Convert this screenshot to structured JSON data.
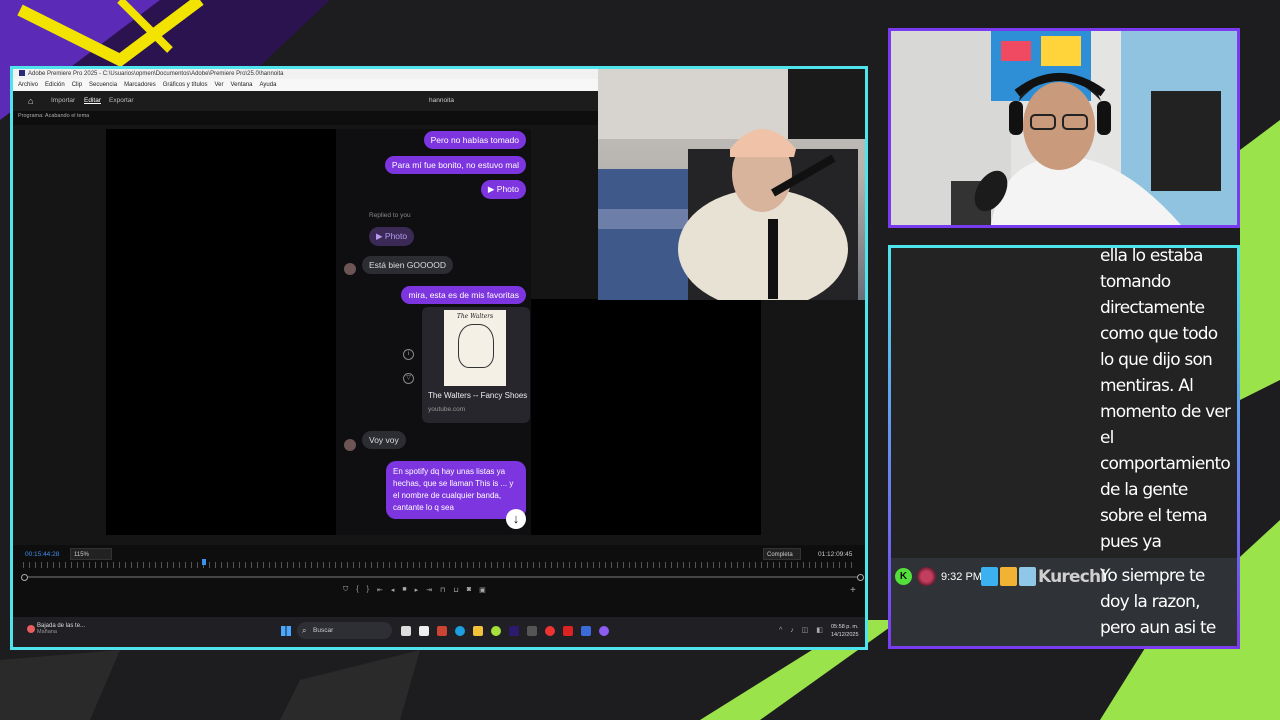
{
  "premiere": {
    "window_title": "Adobe Premiere Pro 2025 - C:\\Usuarios\\opmen\\Documentos\\Adobe\\Premiere Pro\\25.0\\hannoita",
    "menu": [
      "Archivo",
      "Edición",
      "Clip",
      "Secuencia",
      "Marcadores",
      "Gráficos y títulos",
      "Ver",
      "Ventana",
      "Ayuda"
    ],
    "nav": {
      "importar": "Importar",
      "editar": "Editar",
      "exportar": "Exportar"
    },
    "project_name": "hannoita",
    "panel_tab": "Programa: Acabando el tema",
    "timecode_current": "00:15:44:28",
    "zoom": "115%",
    "quality": "Completa",
    "timecode_duration": "01:12:09:45"
  },
  "chat_screenshot": {
    "messages": [
      {
        "text": "Pero no habías tomado",
        "from": "me"
      },
      {
        "text": "Para mí fue bonito, no estuvo mal",
        "from": "me"
      },
      {
        "text": "▶ Photo",
        "from": "me"
      },
      {
        "text": "Replied to you",
        "from": "meta"
      },
      {
        "text": "▶ Photo",
        "from": "them"
      },
      {
        "text": "Está bien GOOOOD",
        "from": "them"
      },
      {
        "text": "mira, esta es de mis favoritas",
        "from": "me"
      },
      {
        "text": "Voy voy",
        "from": "them"
      },
      {
        "text": "En spotify dq hay unas listas ya hechas, que se llaman This is ... y el nombre de cualquier banda, cantante lo q sea",
        "from": "me"
      }
    ],
    "link_card": {
      "title": "The Walters -- Fancy Shoes",
      "url": "youtube.com",
      "cover_text": "The Walters"
    }
  },
  "taskbar": {
    "weather_title": "Bajada de las te...",
    "weather_sub": "Mañana",
    "search_placeholder": "Buscar",
    "time": "05:58 p. m.",
    "date": "14/12/2025"
  },
  "stream_chat": {
    "message_above": "ella lo estaba tomando directamente como que todo lo que dijo son mentiras. Al momento de ver el comportamiento de la gente sobre el tema pues ya decidieron tomarlo en serio",
    "badge_letter": "K",
    "time": "9:32 PM",
    "username": "Kurechi",
    "message": "Yo siempre te doy la razon, pero aun asi te funo"
  },
  "colors": {
    "frame_cyan": "#4fe3ec",
    "frame_purple": "#7a3bf0",
    "accent_green": "#9be34a",
    "bubble_purple": "#7d35e0"
  }
}
